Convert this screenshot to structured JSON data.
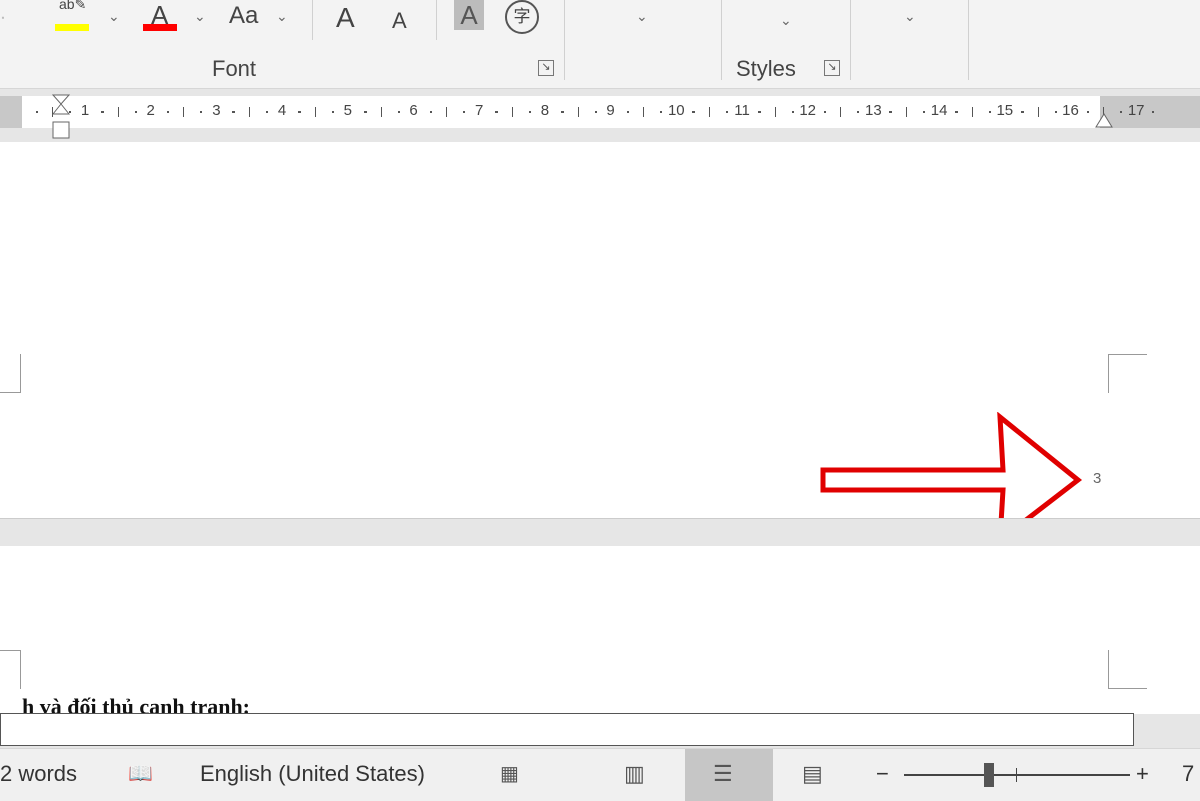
{
  "ribbon": {
    "font_group_label": "Font",
    "styles_group_label": "Styles",
    "change_case_label": "Aa",
    "grow_font_label": "A",
    "shrink_font_label": "A",
    "char_shading_label": "A",
    "enclose_label": "字",
    "font_color_label": "A",
    "highlight_color": "#ffff00",
    "font_color": "#ff0000"
  },
  "ruler": {
    "numbers": [
      "1",
      "2",
      "3",
      "4",
      "5",
      "6",
      "7",
      "8",
      "9",
      "10",
      "11",
      "12",
      "13",
      "14",
      "15",
      "16",
      "17"
    ]
  },
  "document": {
    "page_number": "3",
    "heading_fragment": "h và đối thủ cạnh tranh:",
    "annotation_color": "#e00000"
  },
  "status": {
    "word_count": "2 words",
    "language": "English (United States)",
    "zoom_fragment": "7"
  }
}
